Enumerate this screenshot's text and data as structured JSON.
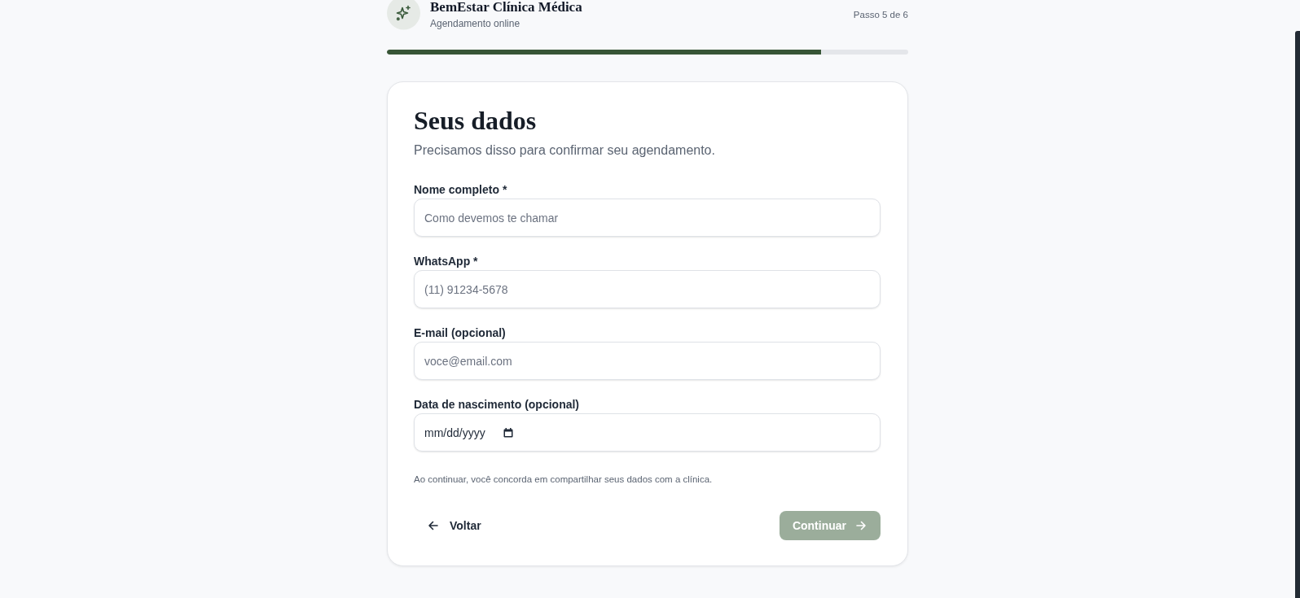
{
  "header": {
    "title": "BemEstar Clínica Médica",
    "subtitle": "Agendamento online",
    "step": "Passo 5 de 6"
  },
  "progress": {
    "level": 0.833
  },
  "form": {
    "title": "Seus dados",
    "subtitle": "Precisamos disso para confirmar seu agendamento.",
    "fields": [
      {
        "kind": "text",
        "label": "Nome completo *",
        "placeholder": "Como devemos te chamar"
      },
      {
        "kind": "text",
        "label": "WhatsApp *",
        "placeholder": "(11) 91234-5678"
      },
      {
        "kind": "text",
        "label": "E-mail (opcional)",
        "placeholder": "voce@email.com"
      },
      {
        "kind": "date",
        "label": "Data de nascimento (opcional)",
        "placeholder": "mm/dd/yyyy"
      }
    ],
    "notice": "Ao continuar, você concorda em compartilhar seus dados com a clínica.",
    "buttons": [
      {
        "kind": "back",
        "label": "Voltar",
        "disabled": false
      },
      {
        "kind": "next",
        "label": "Continuar",
        "disabled": true
      }
    ]
  }
}
